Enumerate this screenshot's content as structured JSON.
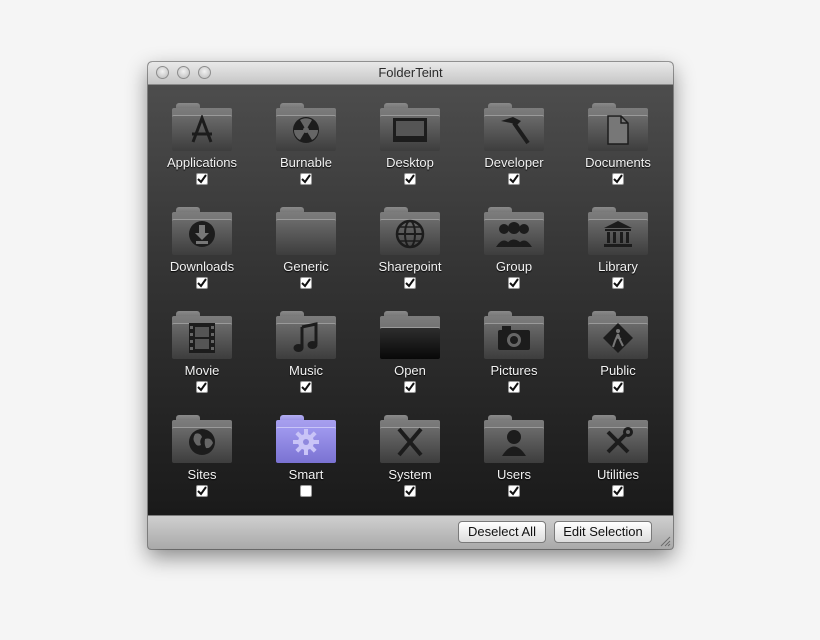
{
  "window": {
    "title": "FolderTeint"
  },
  "folders": [
    {
      "label": "Applications",
      "icon": "app-store-a-icon",
      "checked": true
    },
    {
      "label": "Burnable",
      "icon": "radiation-icon",
      "checked": true
    },
    {
      "label": "Desktop",
      "icon": "desktop-screen-icon",
      "checked": true
    },
    {
      "label": "Developer",
      "icon": "hammer-icon",
      "checked": true
    },
    {
      "label": "Documents",
      "icon": "document-icon",
      "checked": true
    },
    {
      "label": "Downloads",
      "icon": "download-arrow-icon",
      "checked": true
    },
    {
      "label": "Generic",
      "icon": "generic-folder-icon",
      "checked": true
    },
    {
      "label": "Sharepoint",
      "icon": "globe-network-icon",
      "checked": true
    },
    {
      "label": "Group",
      "icon": "group-people-icon",
      "checked": true
    },
    {
      "label": "Library",
      "icon": "library-building-icon",
      "checked": true
    },
    {
      "label": "Movie",
      "icon": "film-strip-icon",
      "checked": true
    },
    {
      "label": "Music",
      "icon": "music-note-icon",
      "checked": true
    },
    {
      "label": "Open",
      "icon": "open-folder-icon",
      "checked": true
    },
    {
      "label": "Pictures",
      "icon": "camera-icon",
      "checked": true
    },
    {
      "label": "Public",
      "icon": "public-sign-icon",
      "checked": true
    },
    {
      "label": "Sites",
      "icon": "globe-icon",
      "checked": true
    },
    {
      "label": "Smart",
      "icon": "gear-icon",
      "checked": false,
      "color": "#9b94ec"
    },
    {
      "label": "System",
      "icon": "system-x-icon",
      "checked": true
    },
    {
      "label": "Users",
      "icon": "user-silhouette-icon",
      "checked": true
    },
    {
      "label": "Utilities",
      "icon": "tools-icon",
      "checked": true
    }
  ],
  "buttons": {
    "deselect_all": "Deselect All",
    "edit_selection": "Edit Selection"
  }
}
